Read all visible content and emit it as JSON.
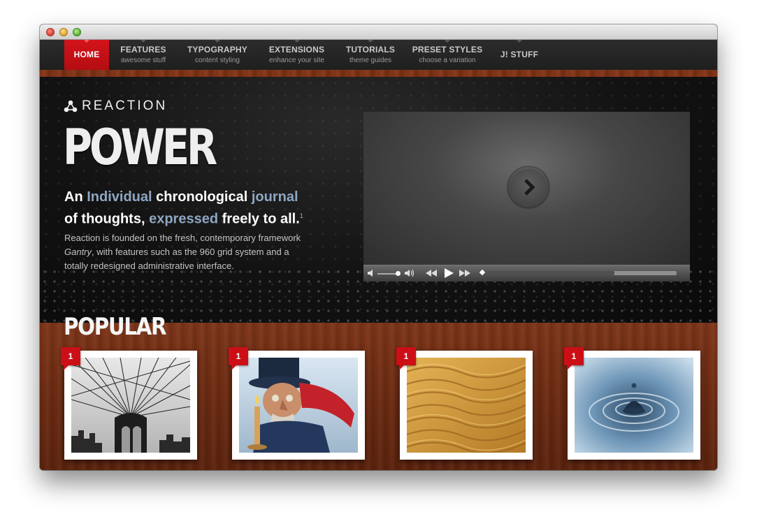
{
  "window": {
    "controls": [
      "close",
      "minimize",
      "zoom"
    ]
  },
  "nav": {
    "items": [
      {
        "label": "HOME",
        "sub": ""
      },
      {
        "label": "FEATURES",
        "sub": "awesome stuff"
      },
      {
        "label": "TYPOGRAPHY",
        "sub": "content styling"
      },
      {
        "label": "EXTENSIONS",
        "sub": "enhance your site"
      },
      {
        "label": "TUTORIALS",
        "sub": "theme guides"
      },
      {
        "label": "PRESET STYLES",
        "sub": "choose a variation"
      },
      {
        "label": "J! STUFF",
        "sub": ""
      }
    ]
  },
  "hero": {
    "logo_text": "REACTION",
    "headline": "POWER",
    "tagline": {
      "w1": "An",
      "w2": "Individual",
      "w3": "chronological",
      "w4": "journal",
      "w5": "of thoughts,",
      "w6": "expressed",
      "w7": "freely to all.",
      "sup": "1"
    },
    "desc": {
      "part1": "Reaction is founded on the fresh, contemporary framework",
      "em": "Gantry",
      "part2": ", with features such as the 960 grid system and a totally redesigned administrative interface."
    }
  },
  "video": {
    "progress_fraction": 0.68,
    "volume_fraction": 0.85
  },
  "popular": {
    "title": "POPULAR",
    "items": [
      {
        "badge": "1",
        "image": "bridge-cables-photo"
      },
      {
        "badge": "1",
        "image": "scrooge-illustration"
      },
      {
        "badge": "1",
        "image": "sand-dunes-photo"
      },
      {
        "badge": "1",
        "image": "water-drop-photo"
      }
    ]
  },
  "colors": {
    "accent": "#cc0f16",
    "highlight": "#8ea6c2",
    "wood": "#6d2b13"
  }
}
